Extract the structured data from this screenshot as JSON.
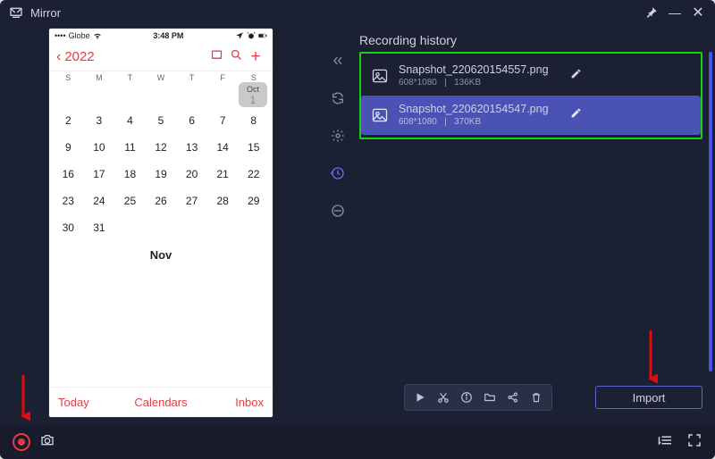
{
  "app": {
    "title": "Mirror"
  },
  "phone": {
    "carrier": "Globe",
    "time": "3:48 PM",
    "year": "2022",
    "dow": [
      "S",
      "M",
      "T",
      "W",
      "T",
      "F",
      "S"
    ],
    "badge": {
      "month": "Oct",
      "day": "1"
    },
    "weeks": [
      [
        "2",
        "3",
        "4",
        "5",
        "6",
        "7",
        "8"
      ],
      [
        "9",
        "10",
        "11",
        "12",
        "13",
        "14",
        "15"
      ],
      [
        "16",
        "17",
        "18",
        "19",
        "20",
        "21",
        "22"
      ],
      [
        "23",
        "24",
        "25",
        "26",
        "27",
        "28",
        "29"
      ],
      [
        "30",
        "31",
        "",
        "",
        "",
        "",
        ""
      ]
    ],
    "next_month_label": "Nov",
    "footer": {
      "today": "Today",
      "calendars": "Calendars",
      "inbox": "Inbox"
    }
  },
  "right": {
    "header": "Recording history",
    "items": [
      {
        "filename": "Snapshot_220620154557.png",
        "dims": "608*1080",
        "size": "136KB"
      },
      {
        "filename": "Snapshot_220620154547.png",
        "dims": "608*1080",
        "size": "370KB"
      }
    ],
    "import_label": "Import"
  },
  "icons": {
    "sync": "sync",
    "settings": "settings",
    "history": "history",
    "exit": "exit",
    "collapse": "collapse",
    "play": "play",
    "cut": "cut",
    "info": "info",
    "folder": "folder",
    "share": "share",
    "delete": "delete",
    "pin": "pin",
    "minimize": "minimize",
    "close": "close",
    "list": "list",
    "fullscreen": "fullscreen",
    "box": "box",
    "search": "search",
    "add": "add"
  }
}
